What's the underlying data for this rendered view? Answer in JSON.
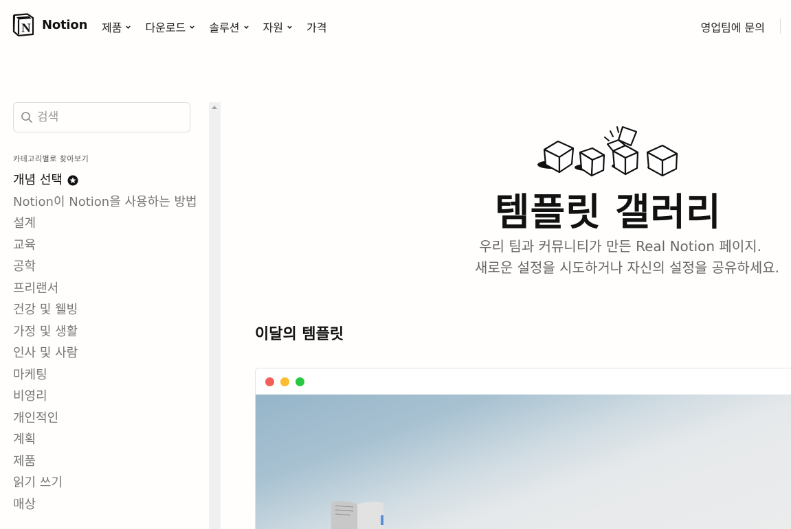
{
  "brand": {
    "name": "Notion"
  },
  "nav": {
    "items": [
      {
        "label": "제품",
        "has_dropdown": true
      },
      {
        "label": "다운로드",
        "has_dropdown": true
      },
      {
        "label": "솔루션",
        "has_dropdown": true
      },
      {
        "label": "자원",
        "has_dropdown": true
      },
      {
        "label": "가격",
        "has_dropdown": false
      }
    ],
    "contact_sales": "영업팀에 문의"
  },
  "sidebar": {
    "search_placeholder": "검색",
    "category_heading": "카테고리별로 찾아보기",
    "active_category": "개념 선택",
    "categories": [
      "Notion이 Notion을 사용하는 방법",
      "설계",
      "교육",
      "공학",
      "프리랜서",
      "건강 및 웰빙",
      "가정 및 생활",
      "인사 및 사람",
      "마케팅",
      "비영리",
      "개인적인",
      "계획",
      "제품",
      "읽기 쓰기",
      "매상"
    ]
  },
  "hero": {
    "title": "템플릿 갤러리",
    "subtitle_line1": "우리 팀과 커뮤니티가 만든 Real Notion 페이지.",
    "subtitle_line2": "새로운 설정을 시도하거나 자신의 설정을 공유하세요."
  },
  "featured": {
    "section_title": "이달의 템플릿"
  },
  "colors": {
    "window_red": "#f25f58",
    "window_yellow": "#fbbc2e",
    "window_green": "#29c841"
  }
}
